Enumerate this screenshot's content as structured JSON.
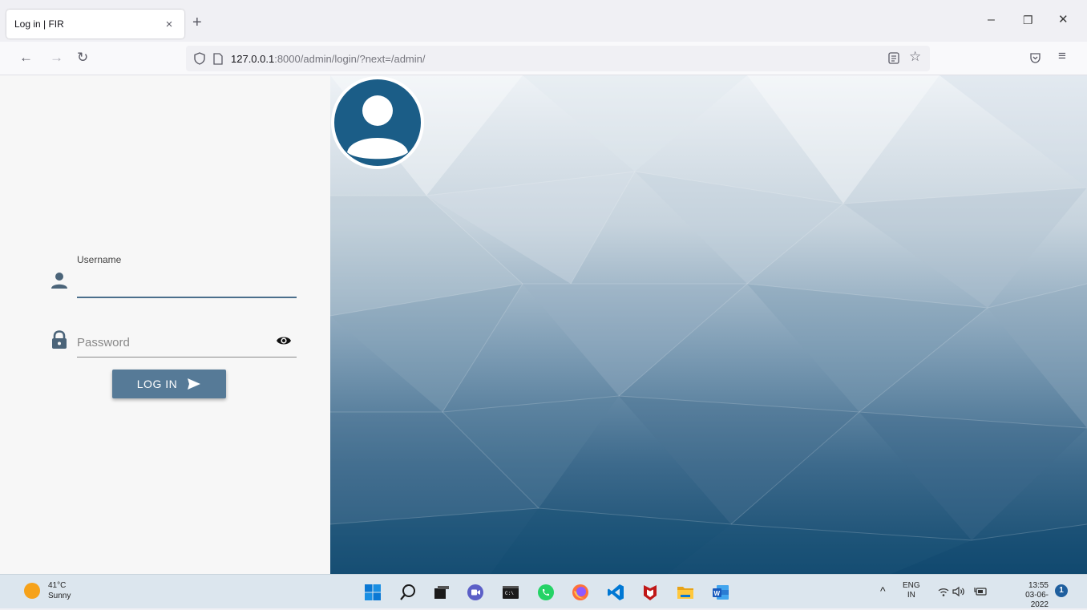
{
  "browser": {
    "tab_title": "Log in | FIR",
    "tab_close": "×",
    "new_tab": "+",
    "url_host": "127.0.0.1",
    "url_path": ":8000/admin/login/?next=/admin/",
    "win_minimize": "–",
    "win_restore": "❐",
    "win_close": "✕"
  },
  "login": {
    "username_label": "Username",
    "username_value": "",
    "password_placeholder": "Password",
    "submit_label": "LOG IN"
  },
  "colors": {
    "accent": "#567a97",
    "avatar_fill": "#1b5d87"
  },
  "taskbar": {
    "temperature": "41°C",
    "condition": "Sunny",
    "language": "ENG",
    "region": "IN",
    "time": "13:55",
    "date": "03-06-2022",
    "notification_count": "1"
  }
}
